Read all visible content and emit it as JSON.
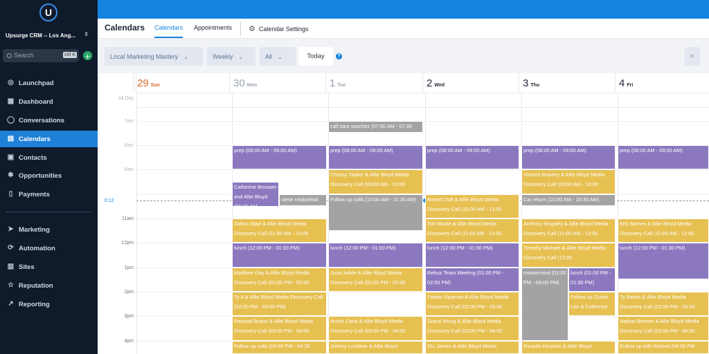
{
  "sidebar": {
    "logo": "U",
    "location": "Upsurge CRM -- Los Ang...",
    "search_placeholder": "Search",
    "search_kbd": "ctrl K",
    "add": "+",
    "items": [
      {
        "label": "Launchpad",
        "icon": "rocket-icon",
        "glyph": "◎"
      },
      {
        "label": "Dashboard",
        "icon": "dashboard-icon",
        "glyph": "▦"
      },
      {
        "label": "Conversations",
        "icon": "chat-icon",
        "glyph": "◯"
      },
      {
        "label": "Calendars",
        "icon": "calendar-icon",
        "glyph": "▤"
      },
      {
        "label": "Contacts",
        "icon": "contacts-icon",
        "glyph": "▣"
      },
      {
        "label": "Opportunities",
        "icon": "opportunities-icon",
        "glyph": "✱"
      },
      {
        "label": "Payments",
        "icon": "payments-icon",
        "glyph": "▯"
      },
      {
        "label": "Marketing",
        "icon": "send-icon",
        "glyph": "➤"
      },
      {
        "label": "Automation",
        "icon": "automation-icon",
        "glyph": "⟳"
      },
      {
        "label": "Sites",
        "icon": "sites-icon",
        "glyph": "▥"
      },
      {
        "label": "Reputation",
        "icon": "star-icon",
        "glyph": "☆"
      },
      {
        "label": "Reporting",
        "icon": "chart-icon",
        "glyph": "↗"
      }
    ],
    "active": "Calendars"
  },
  "header": {
    "title": "Calendars",
    "tabs": [
      "Calendars",
      "Appointments"
    ],
    "settings": "Calendar Settings"
  },
  "toolbar": {
    "calendar": "Local Marketing Mastery",
    "view": "Weekly",
    "filter": "All",
    "today": "Today",
    "help": "?",
    "prev": "<"
  },
  "calendar": {
    "all_day": "All Day",
    "now_label": "0:12",
    "days": [
      {
        "num": "29",
        "name": "Sun"
      },
      {
        "num": "30",
        "name": "Mon"
      },
      {
        "num": "1",
        "name": "Tue"
      },
      {
        "num": "2",
        "name": "Wed"
      },
      {
        "num": "3",
        "name": "Thu"
      },
      {
        "num": "4",
        "name": "Fri"
      }
    ],
    "times": [
      "7am",
      "8am",
      "9am",
      "11am",
      "12pm",
      "1pm",
      "2pm",
      "3pm",
      "4pm"
    ],
    "events": [
      "call sara sanchez (07:00 AM - 07:30",
      "prep (08:00 AM - 09:00 AM)",
      "prep (08:00 AM - 09:00 AM)",
      "prep (08:00 AM - 09:00 AM)",
      "prep (08:00 AM - 09:00 AM)",
      "prep (08:00 AM - 09:00 AM)",
      "Chrissy Tasker & Allie Bloyd Media Discovery Call (09:00 AM - 10:00",
      "Victoria Bravery & Allie Bloyd Media Discovery Call (09:00 AM - 10:00",
      "Catherine Brouwer and Allie Bloyd (09:30 AM -",
      "steve neidzielski",
      "Follow up calls (10:00 AM - 11:30 AM)",
      "Robert Duff & Allie Bloyd Media Discovery Call (10:00 AM - 11:00",
      "Car return (10:00 AM - 10:30 AM)",
      "Zahoo Iqlad & Allie Bloyd Media Discovery Call (11:00 AM - 12:00",
      "Tori Nicole & Allie Bloyd Media Discovery Call (11:00 AM - 12:00",
      "Anthony Kingsley & Allie Bloyd Media Discovery Call (11:00 AM - 12:00",
      "Eric Barnes & Allie Bloyd Media Discovery Call (11:00 AM - 12:00",
      "lunch (12:00 PM - 01:00 PM)",
      "lunch (12:00 PM - 01:00 PM)",
      "lunch (12:00 PM - 01:00 PM)",
      "Timothy Michael & Allie Bloyd Media Discovery Call (12:00",
      "lunch (12:00 PM - 01:30 PM)",
      "Matthew Gay & Allie Bloyd Media Discovery Call (01:00 PM - 02:00",
      "Josie Adele & Allie Bloyd Media Discovery Call (01:00 PM - 02:00",
      "Rebus Team Meeting (01:00 PM - 02:00 PM)",
      "mastermind (01:00 PM - 04:00 PM)",
      "lunch (01:00 PM - 01:30 PM)",
      "Ty A & Allie Bloyd Media Discovery Call (02:00 PM - 03:00 PM)",
      "Fabian Sparrow & Allie Bloyd Media Discovery Call (02:00 PM - 03:00",
      "Follow up Dustin Lee & Catherine",
      "Ty Banks & Allie Bloyd Media Discovery Call (02:00 PM - 03:00",
      "Rachael Braun & Allie Bloyd Media Discovery Call (03:00 PM - 04:00",
      "Andre Caria & Allie Bloyd Media Discovery Call (03:00 PM - 04:00",
      "Grace Wong & Allie Bloyd Media Discovery Call (03:00 PM - 04:00",
      "Nathan Brewer & Allie Bloyd Media Discovery Call (03:00 PM - 04:00",
      "Follow up calls (04:00 PM - 04:30",
      "Johnny Locklear & Allie Bloyd",
      "Stu James & Allie Bloyd Media",
      "Ricardo Houston & Allie Bloyd",
      "Follow up with Roland (04:00 PM -"
    ]
  },
  "colors": {
    "primary": "#1584de",
    "purple": "#8c78bf",
    "yellow": "#e7c052",
    "gray": "#a3a3a3",
    "sidebar": "#0f1a2b"
  }
}
